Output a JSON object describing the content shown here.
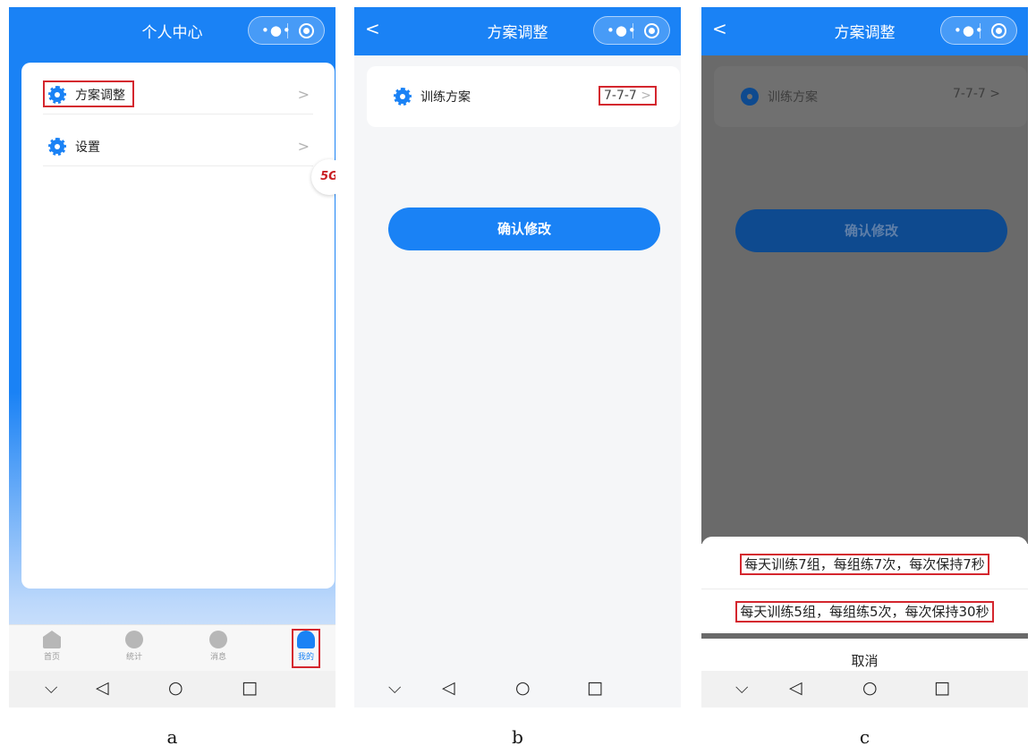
{
  "colors": {
    "primary": "#1a82f5",
    "highlight": "#d4262e"
  },
  "panel_a": {
    "title": "个人中心",
    "capsule": {
      "more_icon": "more-dots-icon",
      "close_icon": "target-icon"
    },
    "menu": [
      {
        "label": "方案调整",
        "icon": "gear-icon"
      },
      {
        "label": "设置",
        "icon": "gear-icon"
      }
    ],
    "badge": "5G",
    "tabs": [
      {
        "label": "首页",
        "icon": "home-icon"
      },
      {
        "label": "统计",
        "icon": "pie-chart-icon"
      },
      {
        "label": "消息",
        "icon": "message-icon"
      },
      {
        "label": "我的",
        "icon": "user-icon"
      }
    ],
    "caption": "a"
  },
  "panel_b": {
    "title": "方案调整",
    "plan_label": "训练方案",
    "plan_value": "7-7-7",
    "confirm_label": "确认修改",
    "caption": "b"
  },
  "panel_c": {
    "title": "方案调整",
    "plan_label": "训练方案",
    "plan_value": "7-7-7",
    "confirm_label": "确认修改",
    "options": [
      "每天训练7组，每组练7次，每次保持7秒",
      "每天训练5组，每组练5次，每次保持30秒"
    ],
    "cancel_label": "取消",
    "caption": "c"
  },
  "system_nav": {
    "down": "⌵",
    "back": "◁",
    "home": "○",
    "recent": "□"
  }
}
